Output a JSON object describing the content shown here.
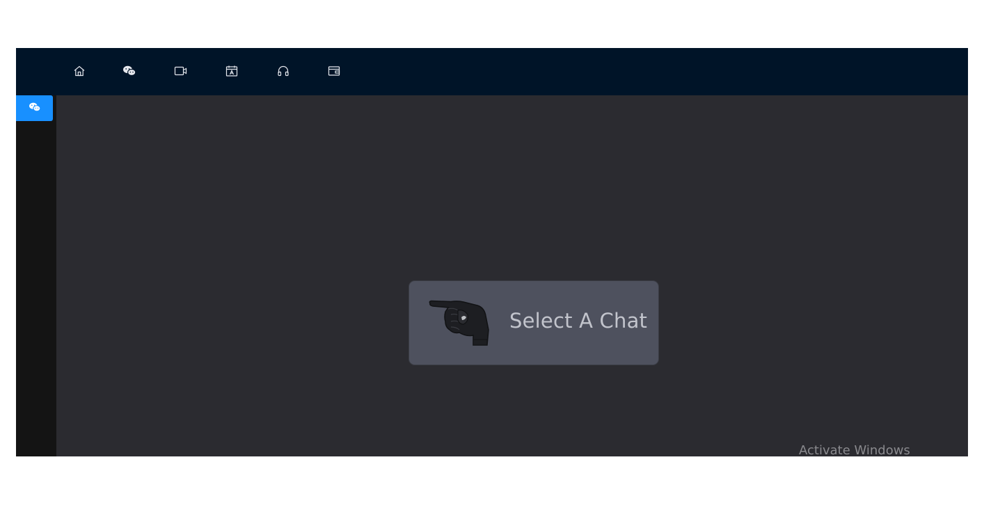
{
  "topbar": {
    "icons": [
      "home-icon",
      "wechat-icon",
      "video-icon",
      "calendar-icon",
      "headphones-icon",
      "wallet-icon"
    ]
  },
  "sidebar": {
    "active_item_icon": "wechat-icon",
    "accent_color": "#1890ff"
  },
  "main": {
    "empty_state_text": "Select A Chat",
    "empty_state_icon": "pointing-hand-icon"
  },
  "watermark": {
    "text": "Activate Windows"
  },
  "colors": {
    "topbar_bg": "#001428",
    "sidebar_bg": "#141414",
    "main_bg": "#2b2b30",
    "card_bg": "#4e515e",
    "card_text": "#c2c4cc"
  }
}
